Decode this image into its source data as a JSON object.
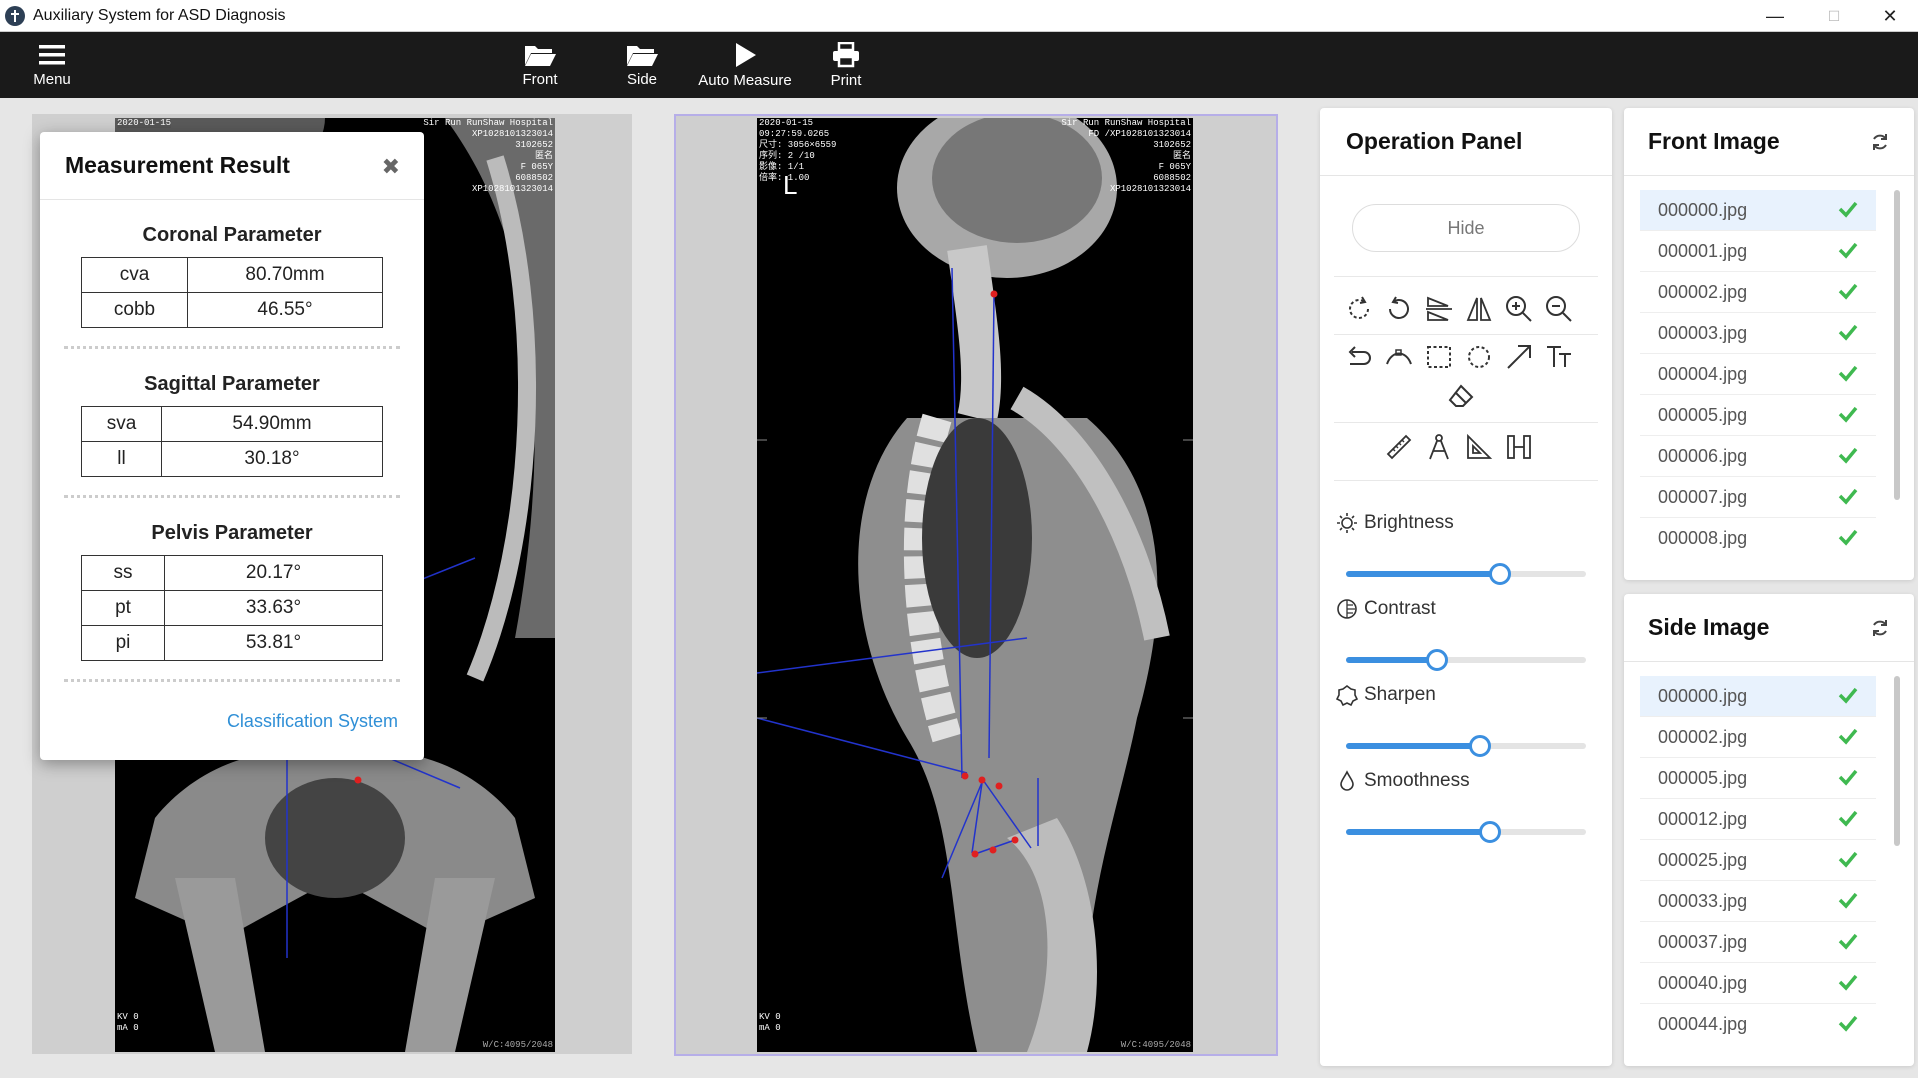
{
  "window": {
    "title": "Auxiliary System for ASD Diagnosis",
    "minimize": "—",
    "maximize": "☐",
    "close": "✕"
  },
  "toolbar": {
    "menu": "Menu",
    "front": "Front",
    "side": "Side",
    "auto_measure": "Auto Measure",
    "print": "Print"
  },
  "xray_front": {
    "header_left": "2020-01-15",
    "header_right": [
      "Sir Run RunShaw Hospital",
      "XP1028101323014",
      "3102652",
      "匿名",
      "F 065Y",
      "6088502",
      "XP1028101323014"
    ],
    "footer_left": [
      "KV 0",
      "mA 0"
    ],
    "footer_right": "W/C:4095/2048"
  },
  "xray_side": {
    "header_left": [
      "2020-01-15",
      "09:27:59.0265",
      "尺寸: 3056×6559",
      "序列: 2 /10",
      "影像: 1/1",
      "倍率: 1.00"
    ],
    "marker": "L",
    "header_right": [
      "Sir Run RunShaw Hospital",
      "FD /XP1028101323014",
      "3102652",
      "匿名",
      "F 065Y",
      "6088502",
      "XP1028101323014"
    ],
    "footer_left": [
      "KV 0",
      "mA 0"
    ],
    "footer_right": "W/C:4095/2048"
  },
  "measurement": {
    "title": "Measurement Result",
    "close": "✖",
    "coronal": {
      "title": "Coronal Parameter",
      "rows": [
        [
          "cva",
          "80.70mm"
        ],
        [
          "cobb",
          "46.55°"
        ]
      ]
    },
    "sagittal": {
      "title": "Sagittal Parameter",
      "rows": [
        [
          "sva",
          "54.90mm"
        ],
        [
          "ll",
          "30.18°"
        ]
      ]
    },
    "pelvis": {
      "title": "Pelvis Parameter",
      "rows": [
        [
          "ss",
          "20.17°"
        ],
        [
          "pt",
          "33.63°"
        ],
        [
          "pi",
          "53.81°"
        ]
      ]
    },
    "link": "Classification System"
  },
  "operation": {
    "title": "Operation Panel",
    "hide": "Hide",
    "brightness": {
      "label": "Brightness",
      "value": 0.64
    },
    "contrast": {
      "label": "Contrast",
      "value": 0.38
    },
    "sharpen": {
      "label": "Sharpen",
      "value": 0.56
    },
    "smoothness": {
      "label": "Smoothness",
      "value": 0.6
    }
  },
  "front_list": {
    "title": "Front Image",
    "items": [
      "000000.jpg",
      "000001.jpg",
      "000002.jpg",
      "000003.jpg",
      "000004.jpg",
      "000005.jpg",
      "000006.jpg",
      "000007.jpg",
      "000008.jpg"
    ]
  },
  "side_list": {
    "title": "Side Image",
    "items": [
      "000000.jpg",
      "000002.jpg",
      "000005.jpg",
      "000012.jpg",
      "000025.jpg",
      "000033.jpg",
      "000037.jpg",
      "000040.jpg",
      "000044.jpg"
    ]
  },
  "colors": {
    "accent": "#3b8fe0",
    "check": "#3fb950",
    "toolbar": "#1a1a1a",
    "link": "#2f8fd6"
  }
}
